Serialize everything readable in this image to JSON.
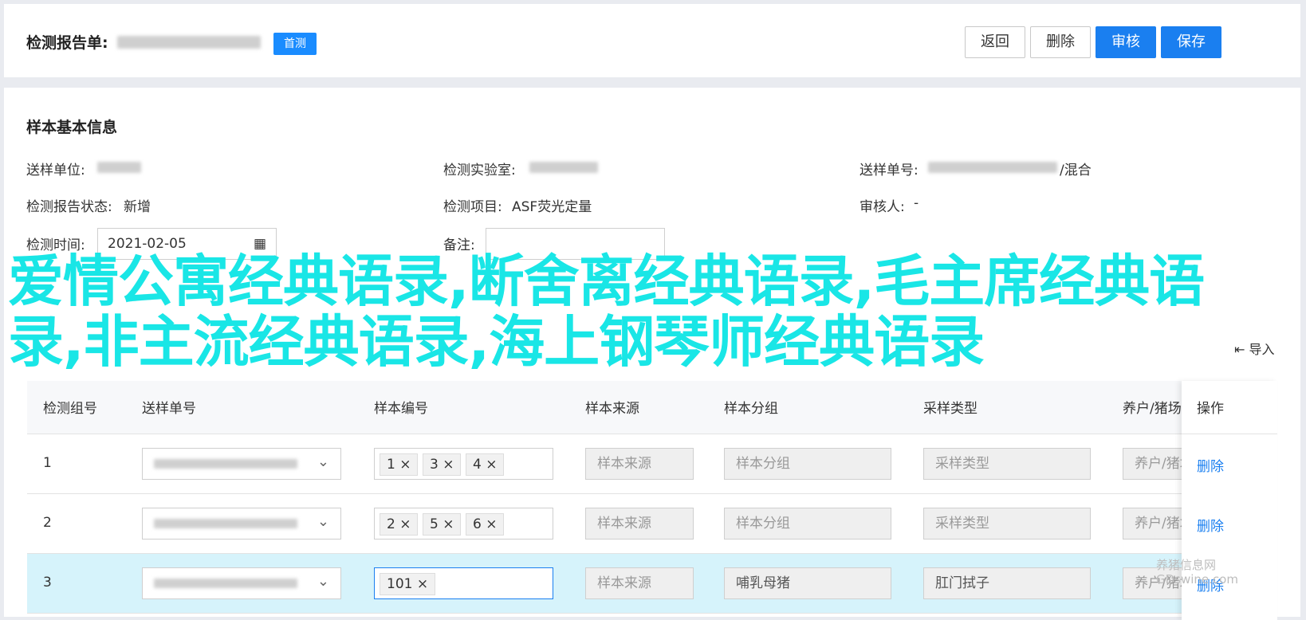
{
  "header": {
    "title": "检测报告单:",
    "home_tag": "首测",
    "buttons": {
      "back": "返回",
      "delete": "删除",
      "review": "审核",
      "save": "保存"
    }
  },
  "section": {
    "title": "样本基本信息"
  },
  "info": {
    "send_unit_label": "送样单位:",
    "lab_label": "检测实验室:",
    "send_no_label": "送样单号:",
    "send_no_suffix": "/混合",
    "report_status_label": "检测报告状态:",
    "report_status_value": "新增",
    "item_label": "检测项目:",
    "item_value": "ASF荧光定量",
    "reviewer_label": "审核人:",
    "reviewer_value": "-",
    "time_label": "检测时间:",
    "time_value": "2021-02-05",
    "note_label": "备注:"
  },
  "overlay_text": "爱情公寓经典语录,断舍离经典语录,毛主席经典语录,非主流经典语录,海上钢琴师经典语录",
  "import_label": "导入",
  "table": {
    "columns": [
      "检测组号",
      "送样单号",
      "样本编号",
      "样本来源",
      "样本分组",
      "采样类型",
      "养户/猪场",
      "操作"
    ],
    "rows": [
      {
        "group": "1",
        "chips": [
          "1",
          "3",
          "4"
        ],
        "source": "样本来源",
        "sgroup": "样本分组",
        "stype": "采样类型",
        "farm": "养户/猪场",
        "op": "删除"
      },
      {
        "group": "2",
        "chips": [
          "2",
          "5",
          "6"
        ],
        "source": "样本来源",
        "sgroup": "样本分组",
        "stype": "采样类型",
        "farm": "养户/猪场",
        "op": "删除"
      },
      {
        "group": "3",
        "chips": [
          "101"
        ],
        "source": "样本来源",
        "sgroup": "哺乳母猪",
        "stype": "肛门拭子",
        "farm": "养户/猪场",
        "op": "删除"
      }
    ]
  },
  "watermark": "养猪信息网 GDswine.com"
}
